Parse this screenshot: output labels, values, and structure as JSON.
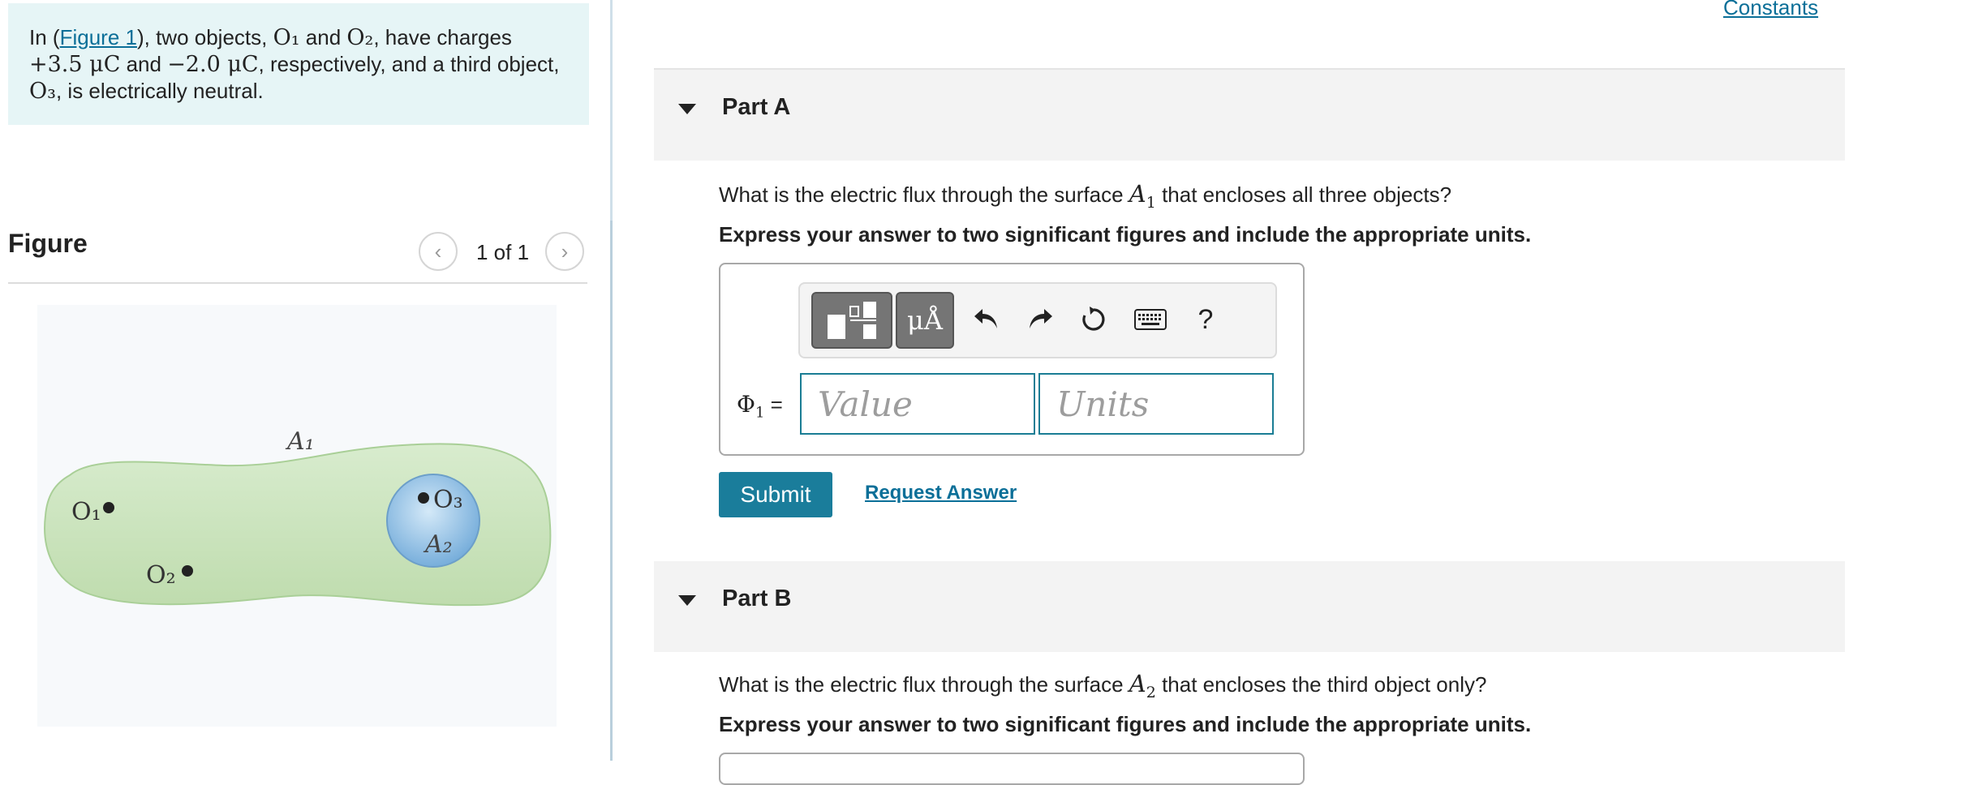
{
  "intro": {
    "prefix": "In (",
    "figure_link": "Figure 1",
    "line1_mid": "), two objects, ",
    "o1": "O₁",
    "and_word": " and ",
    "o2": "O₂",
    "line1_end": ", have charges",
    "charge1": "+3.5 μC",
    "and2": " and ",
    "charge2": "−2.0 μC",
    "line2_end": ", respectively, and a third object,",
    "o3": "O₃",
    "line3_end": ", is electrically neutral."
  },
  "figure": {
    "title": "Figure",
    "counter": "1 of 1",
    "labels": {
      "a1": "A₁",
      "a2": "A₂",
      "o1": "O₁",
      "o2": "O₂",
      "o3": "O₃"
    }
  },
  "header": {
    "constants_link": "Constants"
  },
  "partA": {
    "label": "Part A",
    "question_pre": "What is the electric flux through the surface ",
    "question_sym": "A",
    "question_sub": "1",
    "question_post": " that encloses all three objects?",
    "instruction": "Express your answer to two significant figures and include the appropriate units.",
    "toolbar": {
      "templates": "templates-icon",
      "units_symbol": "μÅ",
      "undo": "undo-icon",
      "redo": "redo-icon",
      "reset": "reset-icon",
      "keyboard": "keyboard-icon",
      "help": "?"
    },
    "answer_symbol": "Φ",
    "answer_symbol_sub": "1",
    "answer_eq": " =",
    "value_placeholder": "Value",
    "units_placeholder": "Units",
    "submit": "Submit",
    "request_answer": "Request Answer"
  },
  "partB": {
    "label": "Part B",
    "question_pre": "What is the electric flux through the surface ",
    "question_sym": "A",
    "question_sub": "2",
    "question_post": " that encloses the third object only?",
    "instruction": "Express your answer to two significant figures and include the appropriate units."
  },
  "colors": {
    "intro_bg": "#e6f5f6",
    "accent": "#1a7d9b",
    "link": "#0b6f98",
    "surface_a1": "#cfe6c3",
    "surface_a2": "#8fc0e6"
  }
}
